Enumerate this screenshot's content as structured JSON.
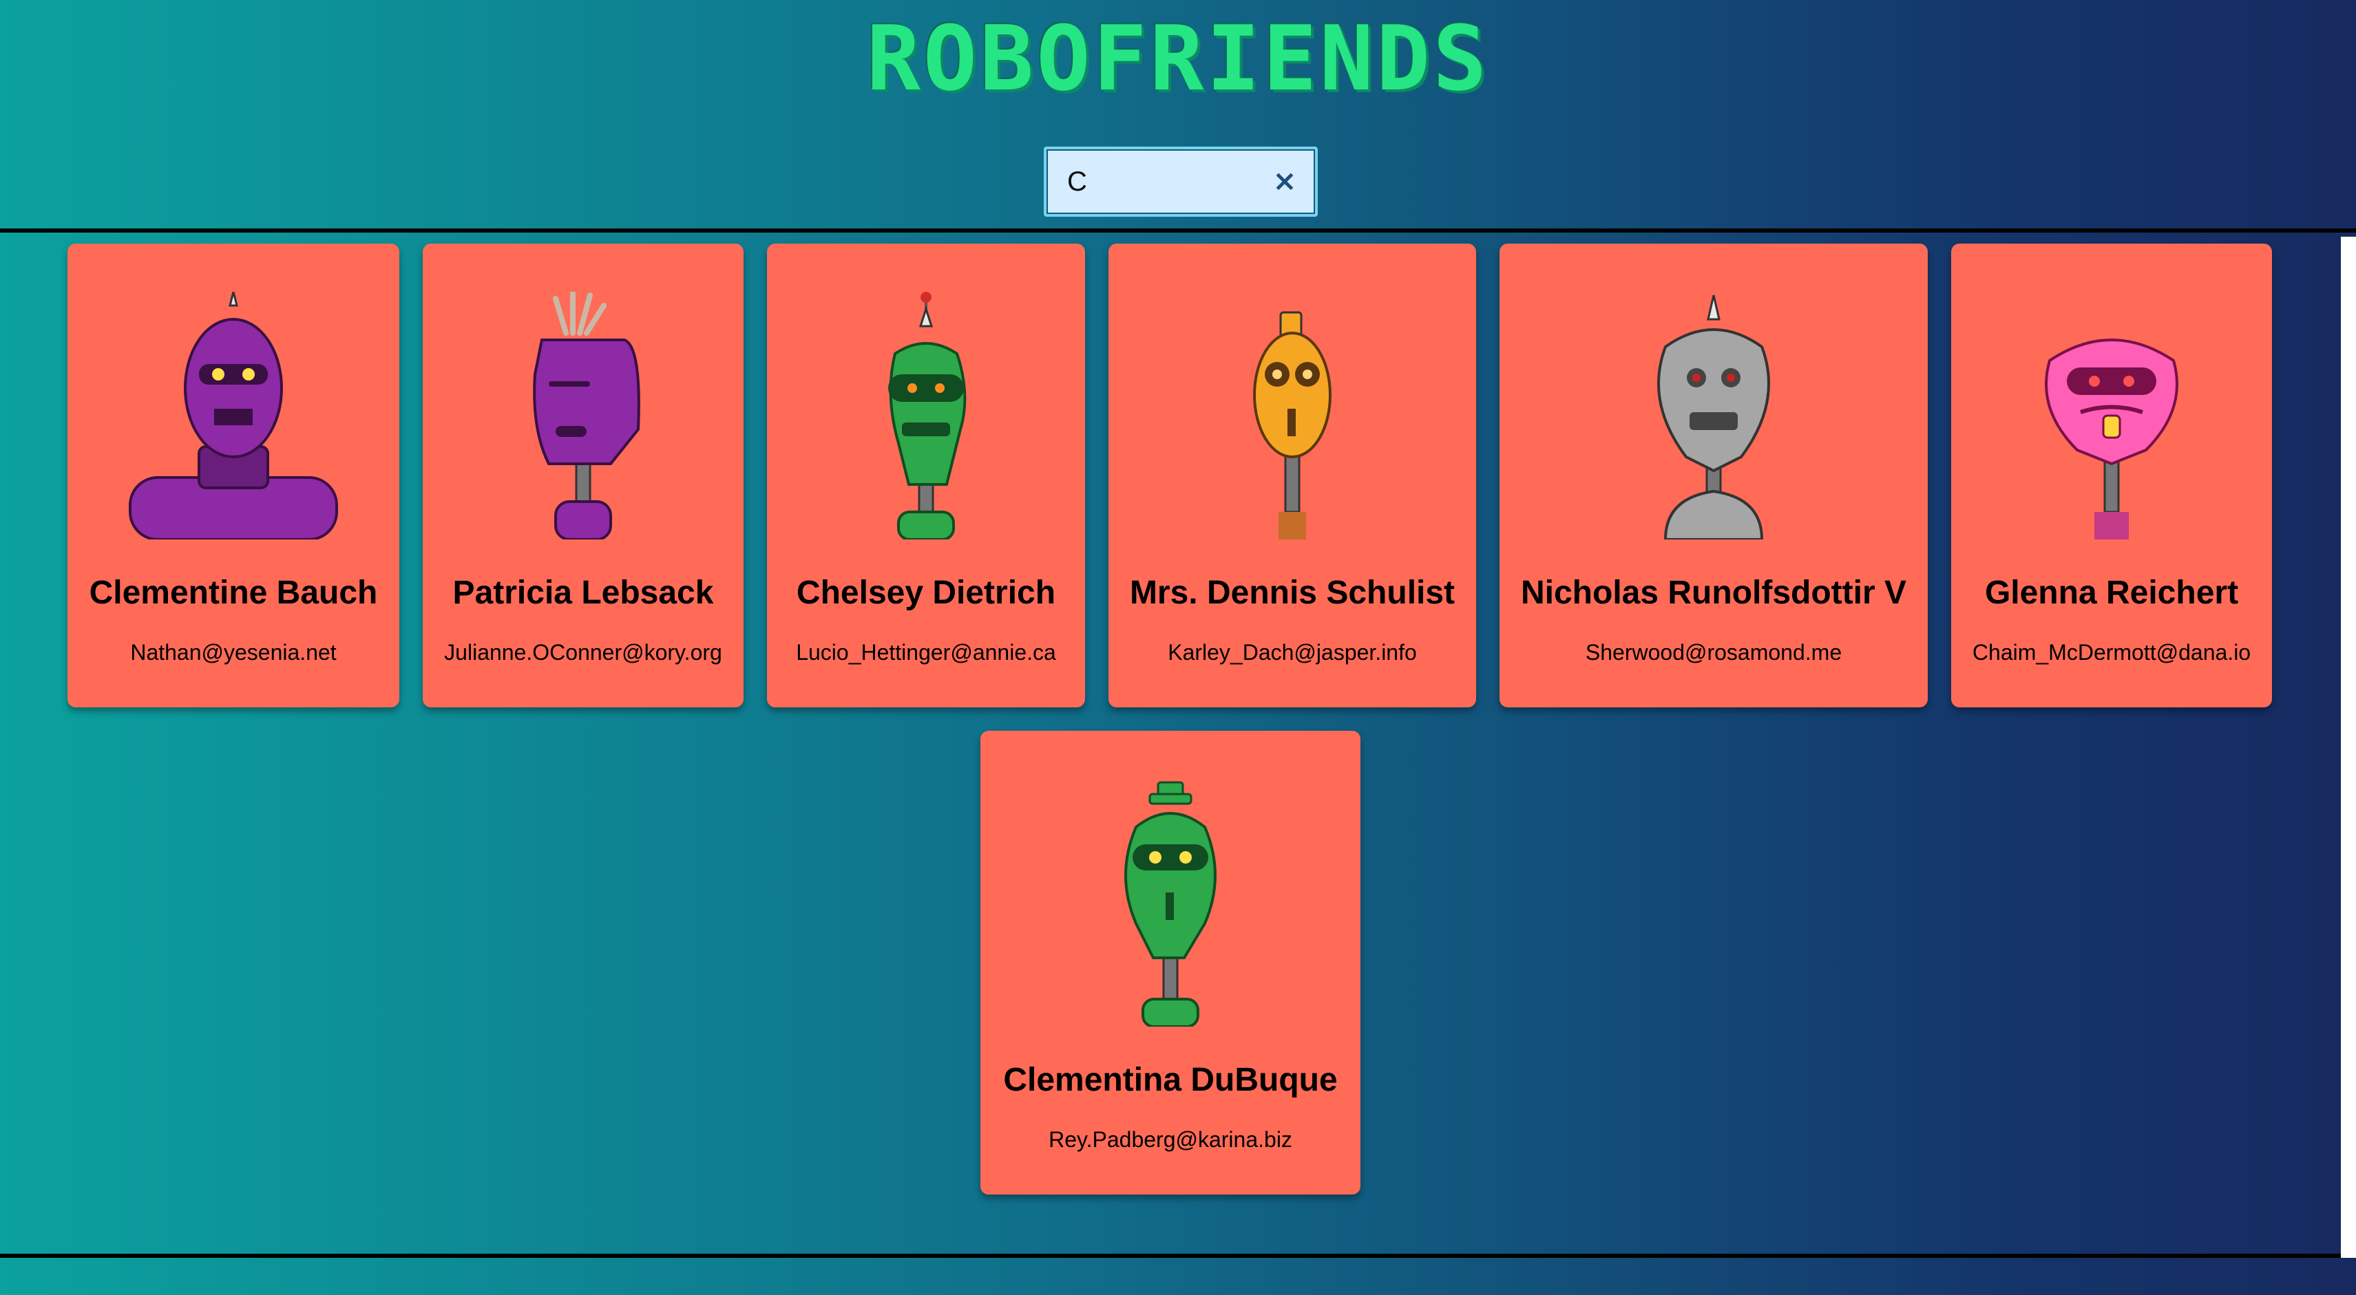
{
  "app": {
    "title": "ROBOFRIENDS"
  },
  "search": {
    "value": "C",
    "clear_label": "×"
  },
  "colors": {
    "card": "#ff6b57",
    "title": "#26e585"
  },
  "robots": [
    {
      "name": "Clementine Bauch",
      "email": "Nathan@yesenia.net",
      "icon": "purple-robot-icon"
    },
    {
      "name": "Patricia Lebsack",
      "email": "Julianne.OConner@kory.org",
      "icon": "purple-robot-icon"
    },
    {
      "name": "Chelsey Dietrich",
      "email": "Lucio_Hettinger@annie.ca",
      "icon": "green-robot-icon"
    },
    {
      "name": "Mrs. Dennis Schulist",
      "email": "Karley_Dach@jasper.info",
      "icon": "orange-robot-icon"
    },
    {
      "name": "Nicholas Runolfsdottir V",
      "email": "Sherwood@rosamond.me",
      "icon": "gray-robot-icon"
    },
    {
      "name": "Glenna Reichert",
      "email": "Chaim_McDermott@dana.io",
      "icon": "pink-robot-icon"
    },
    {
      "name": "Clementina DuBuque",
      "email": "Rey.Padberg@karina.biz",
      "icon": "green-robot-icon"
    }
  ]
}
